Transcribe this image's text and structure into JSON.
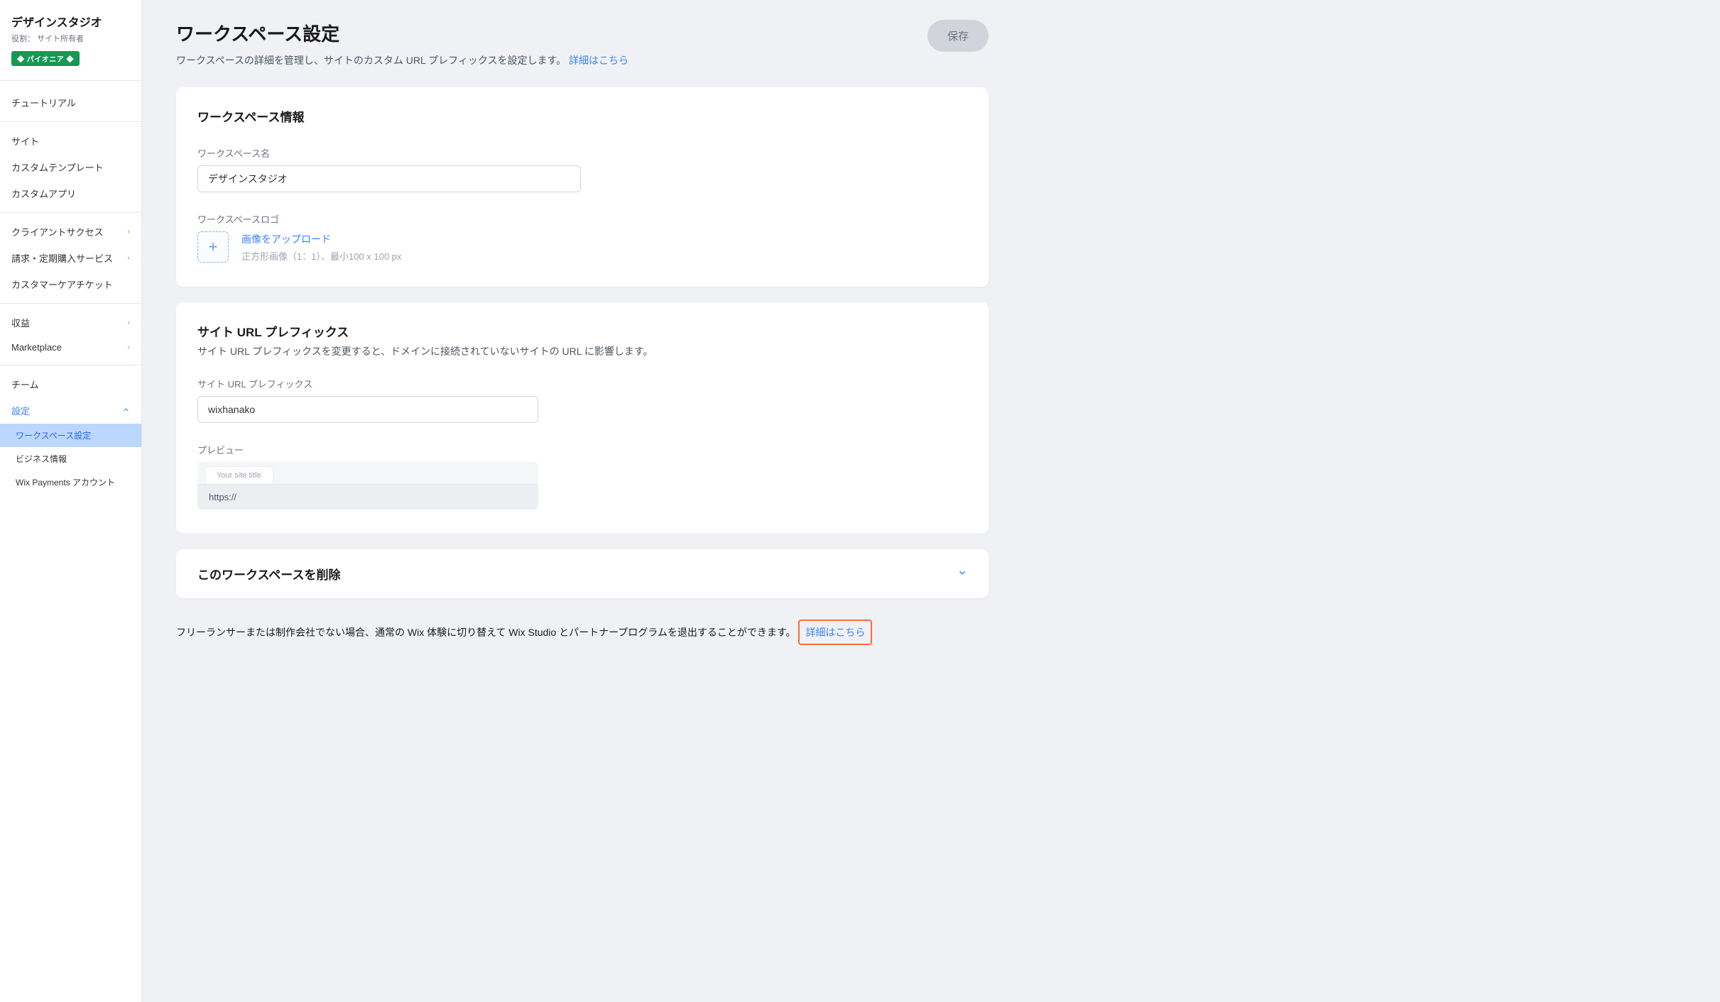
{
  "sidebar": {
    "workspace_name": "デザインスタジオ",
    "role_label": "役割： サイト所有者",
    "badge": "◆ パイオニア ◆",
    "groups": [
      {
        "items": [
          {
            "label": "チュートリアル"
          }
        ]
      },
      {
        "items": [
          {
            "label": "サイト"
          },
          {
            "label": "カスタムテンプレート"
          },
          {
            "label": "カスタムアプリ"
          }
        ]
      },
      {
        "items": [
          {
            "label": "クライアントサクセス",
            "chevron": true
          },
          {
            "label": "請求・定期購入サービス",
            "chevron": true
          },
          {
            "label": "カスタマーケアチケット"
          }
        ]
      },
      {
        "items": [
          {
            "label": "収益",
            "chevron": true
          },
          {
            "label": "Marketplace",
            "chevron": true
          }
        ]
      },
      {
        "items": [
          {
            "label": "チーム"
          },
          {
            "label": "設定",
            "chevron_up": true,
            "active": true,
            "subitems": [
              {
                "label": "ワークスペース設定",
                "selected": true
              },
              {
                "label": "ビジネス情報"
              },
              {
                "label": "Wix Payments アカウント"
              }
            ]
          }
        ]
      }
    ]
  },
  "header": {
    "title": "ワークスペース設定",
    "subtitle_text": "ワークスペースの詳細を管理し、サイトのカスタム URL プレフィックスを設定します。",
    "subtitle_link": "詳細はこちら",
    "save_button": "保存"
  },
  "card_info": {
    "title": "ワークスペース情報",
    "name_label": "ワークスペース名",
    "name_value": "デザインスタジオ",
    "logo_label": "ワークスペースロゴ",
    "upload_link": "画像をアップロード",
    "upload_hint": "正方形画像（1：1）、最小100 x 100 px"
  },
  "card_prefix": {
    "title": "サイト URL プレフィックス",
    "subtitle": "サイト URL プレフィックスを変更すると、ドメインに接続されていないサイトの URL に影響します。",
    "prefix_label": "サイト URL プレフィックス",
    "prefix_value": "wixhanako",
    "preview_label": "プレビュー",
    "preview_tab": "Your site title",
    "preview_url": "https://"
  },
  "card_delete": {
    "title": "このワークスペースを削除"
  },
  "footer": {
    "text": "フリーランサーまたは制作会社でない場合、通常の Wix 体験に切り替えて Wix Studio とパートナープログラムを退出することができます。",
    "link": "詳細はこちら"
  }
}
